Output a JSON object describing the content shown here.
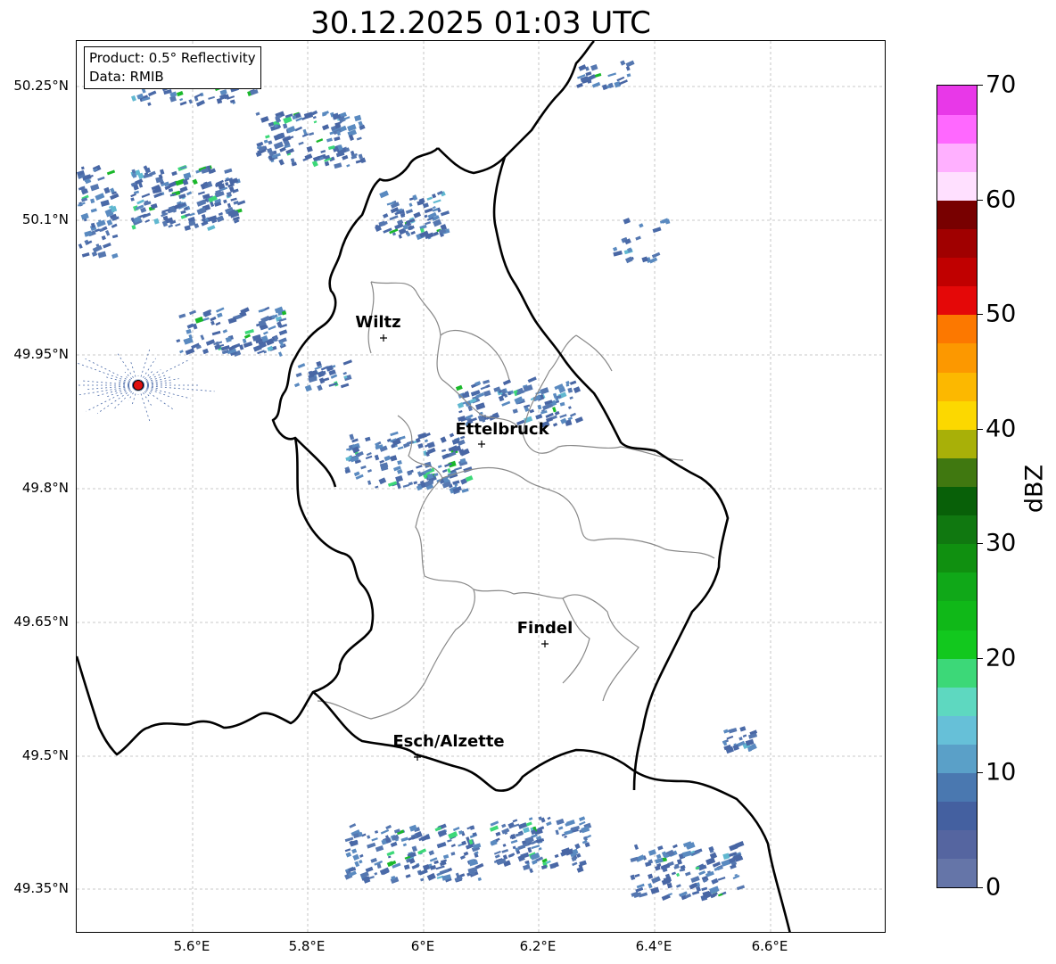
{
  "title": "30.12.2025 01:03 UTC",
  "info_box": {
    "product": "Product: 0.5° Reflectivity",
    "data": "Data: RMIB"
  },
  "lat_labels": [
    "50.25°N",
    "50.1°N",
    "49.95°N",
    "49.8°N",
    "49.65°N",
    "49.5°N",
    "49.35°N"
  ],
  "lon_labels": [
    "5.6°E",
    "5.8°E",
    "6°E",
    "6.2°E",
    "6.4°E",
    "6.6°E"
  ],
  "cities": [
    {
      "name": "Wiltz"
    },
    {
      "name": "Ettelbruck"
    },
    {
      "name": "Findel"
    },
    {
      "name": "Esch/Alzette"
    }
  ],
  "radar_site_color": "#e01010",
  "colorbar": {
    "label": "dBZ",
    "ticks": [
      "0",
      "10",
      "20",
      "30",
      "40",
      "50",
      "60",
      "70"
    ],
    "min": 0,
    "max": 70,
    "step": 2.5,
    "colors": [
      "#6575a8",
      "#5565a0",
      "#4460a0",
      "#4a78b0",
      "#5aa0c8",
      "#66c0d8",
      "#5ed8c0",
      "#3cd878",
      "#12c81e",
      "#10b818",
      "#10a818",
      "#109010",
      "#107810",
      "#086008",
      "#407810",
      "#a8b008",
      "#fcd800",
      "#fcb800",
      "#fc9800",
      "#fc7800",
      "#e40808",
      "#c00000",
      "#a00000",
      "#780000",
      "#ffe0ff",
      "#ffb0ff",
      "#ff68ff",
      "#e838e8"
    ]
  }
}
